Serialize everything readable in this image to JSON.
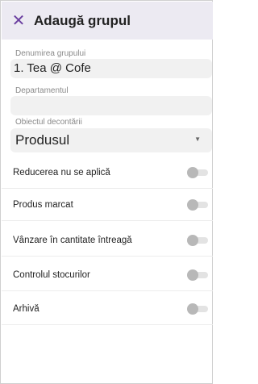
{
  "header": {
    "close_icon": "close-icon",
    "title": "Adaugă grupul"
  },
  "form": {
    "group_name": {
      "label": "Denumirea grupului",
      "value": "1. Tea @ Cofe"
    },
    "department": {
      "label": "Departamentul",
      "value": ""
    },
    "settlement_object": {
      "label": "Obiectul decontării",
      "value": "Produsul"
    }
  },
  "toggles": [
    {
      "label": "Reducerea nu se aplică",
      "enabled": false
    },
    {
      "label": "Produs marcat",
      "enabled": false
    },
    {
      "label": "Vânzare în cantitate întreagă",
      "enabled": false
    },
    {
      "label": "Controlul stocurilor",
      "enabled": false
    },
    {
      "label": "Arhivă",
      "enabled": false
    }
  ],
  "colors": {
    "accent": "#6b3fa0",
    "appbar_bg": "#eceaf2",
    "field_bg": "#f1f1f1",
    "toggle_off": "#b8b8b8"
  }
}
